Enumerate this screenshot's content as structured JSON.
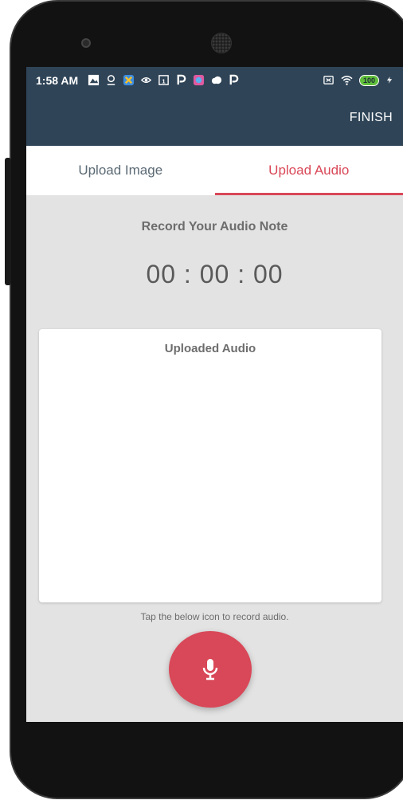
{
  "status_bar": {
    "time": "1:58 AM",
    "battery": "100",
    "icons": [
      "image-icon",
      "location-icon",
      "app-icon",
      "eye-icon",
      "calendar-icon",
      "p-icon",
      "app2-icon",
      "cloud-icon",
      "p-icon",
      "sim-icon",
      "wifi-icon",
      "battery-icon",
      "charging-icon"
    ]
  },
  "app_bar": {
    "finish_label": "FINISH"
  },
  "tabs": [
    {
      "label": "Upload Image",
      "active": false
    },
    {
      "label": "Upload Audio",
      "active": true
    }
  ],
  "main": {
    "record_title": "Record Your Audio Note",
    "timer": "00 : 00 : 00",
    "uploaded_title": "Uploaded Audio",
    "hint": "Tap the below icon to record audio."
  },
  "colors": {
    "primary": "#2f4457",
    "accent": "#d94858",
    "background": "#e3e3e3"
  },
  "mic_icon": "microphone-icon"
}
